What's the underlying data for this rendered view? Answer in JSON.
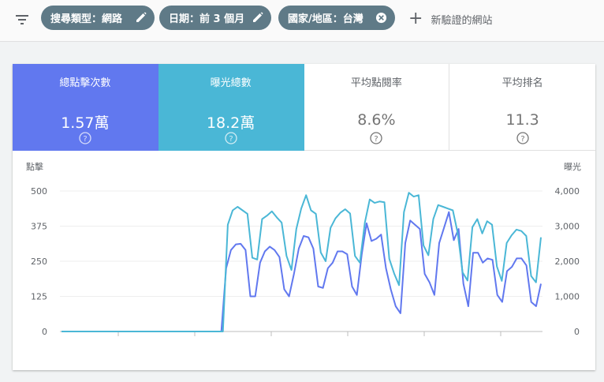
{
  "filters": {
    "chips": [
      {
        "label": "搜尋類型：網路",
        "action": "edit"
      },
      {
        "label": "日期：前 3 個月",
        "action": "edit"
      },
      {
        "label": "國家/地區：台灣",
        "action": "remove"
      }
    ],
    "add_site_label": "新驗證的網站"
  },
  "metrics": [
    {
      "label": "總點擊次數",
      "value": "1.57萬",
      "selected": true,
      "color": "#6178ef"
    },
    {
      "label": "曝光總數",
      "value": "18.2萬",
      "selected": true,
      "color": "#4ab7d6"
    },
    {
      "label": "平均點閱率",
      "value": "8.6%",
      "selected": false
    },
    {
      "label": "平均排名",
      "value": "11.3",
      "selected": false
    }
  ],
  "chart_data": {
    "type": "line",
    "left_axis_label": "點擊",
    "right_axis_label": "曝光",
    "left_ylim": [
      0,
      500
    ],
    "right_ylim": [
      0,
      4000
    ],
    "left_ticks": [
      "0",
      "125",
      "250",
      "375",
      "500"
    ],
    "right_ticks": [
      "0",
      "1,000",
      "2,000",
      "3,000",
      "4,000"
    ],
    "grid": true,
    "series": [
      {
        "axis": "left",
        "color": "#6178ef",
        "values": [
          0,
          0,
          0,
          0,
          0,
          0,
          0,
          0,
          0,
          0,
          0,
          0,
          0,
          0,
          0,
          0,
          0,
          0,
          0,
          0,
          0,
          0,
          0,
          0,
          0,
          0,
          0,
          0,
          0,
          0,
          0,
          0,
          0,
          0,
          225,
          290,
          310,
          312,
          290,
          125,
          125,
          245,
          285,
          302,
          290,
          265,
          150,
          125,
          205,
          295,
          340,
          335,
          295,
          160,
          155,
          225,
          245,
          285,
          285,
          275,
          160,
          130,
          275,
          385,
          322,
          330,
          345,
          225,
          150,
          90,
          65,
          315,
          395,
          380,
          365,
          205,
          175,
          130,
          315,
          370,
          425,
          325,
          365,
          170,
          90,
          280,
          280,
          245,
          260,
          255,
          130,
          105,
          215,
          230,
          260,
          260,
          235,
          105,
          90,
          170
        ]
      },
      {
        "axis": "right",
        "color": "#4ab7d6",
        "values": [
          0,
          0,
          0,
          0,
          0,
          0,
          0,
          0,
          0,
          0,
          0,
          0,
          0,
          0,
          0,
          0,
          0,
          0,
          0,
          0,
          0,
          0,
          0,
          0,
          0,
          0,
          0,
          0,
          0,
          0,
          0,
          0,
          0,
          0,
          3040,
          3450,
          3550,
          3450,
          3350,
          2100,
          2050,
          3200,
          3300,
          3420,
          3250,
          3100,
          2150,
          1750,
          2920,
          3500,
          3880,
          3450,
          3350,
          2250,
          2000,
          2950,
          3220,
          3380,
          3480,
          3360,
          2150,
          1960,
          3100,
          3760,
          3660,
          3700,
          3680,
          2070,
          1650,
          1320,
          3400,
          3950,
          3840,
          3880,
          2450,
          2170,
          3200,
          3600,
          3550,
          3500,
          3450,
          2800,
          1680,
          1450,
          2970,
          3200,
          2790,
          3140,
          3040,
          1850,
          1440,
          2520,
          2740,
          2900,
          2860,
          2720,
          1580,
          1400,
          2680
        ]
      }
    ],
    "x_ticks": 7
  }
}
